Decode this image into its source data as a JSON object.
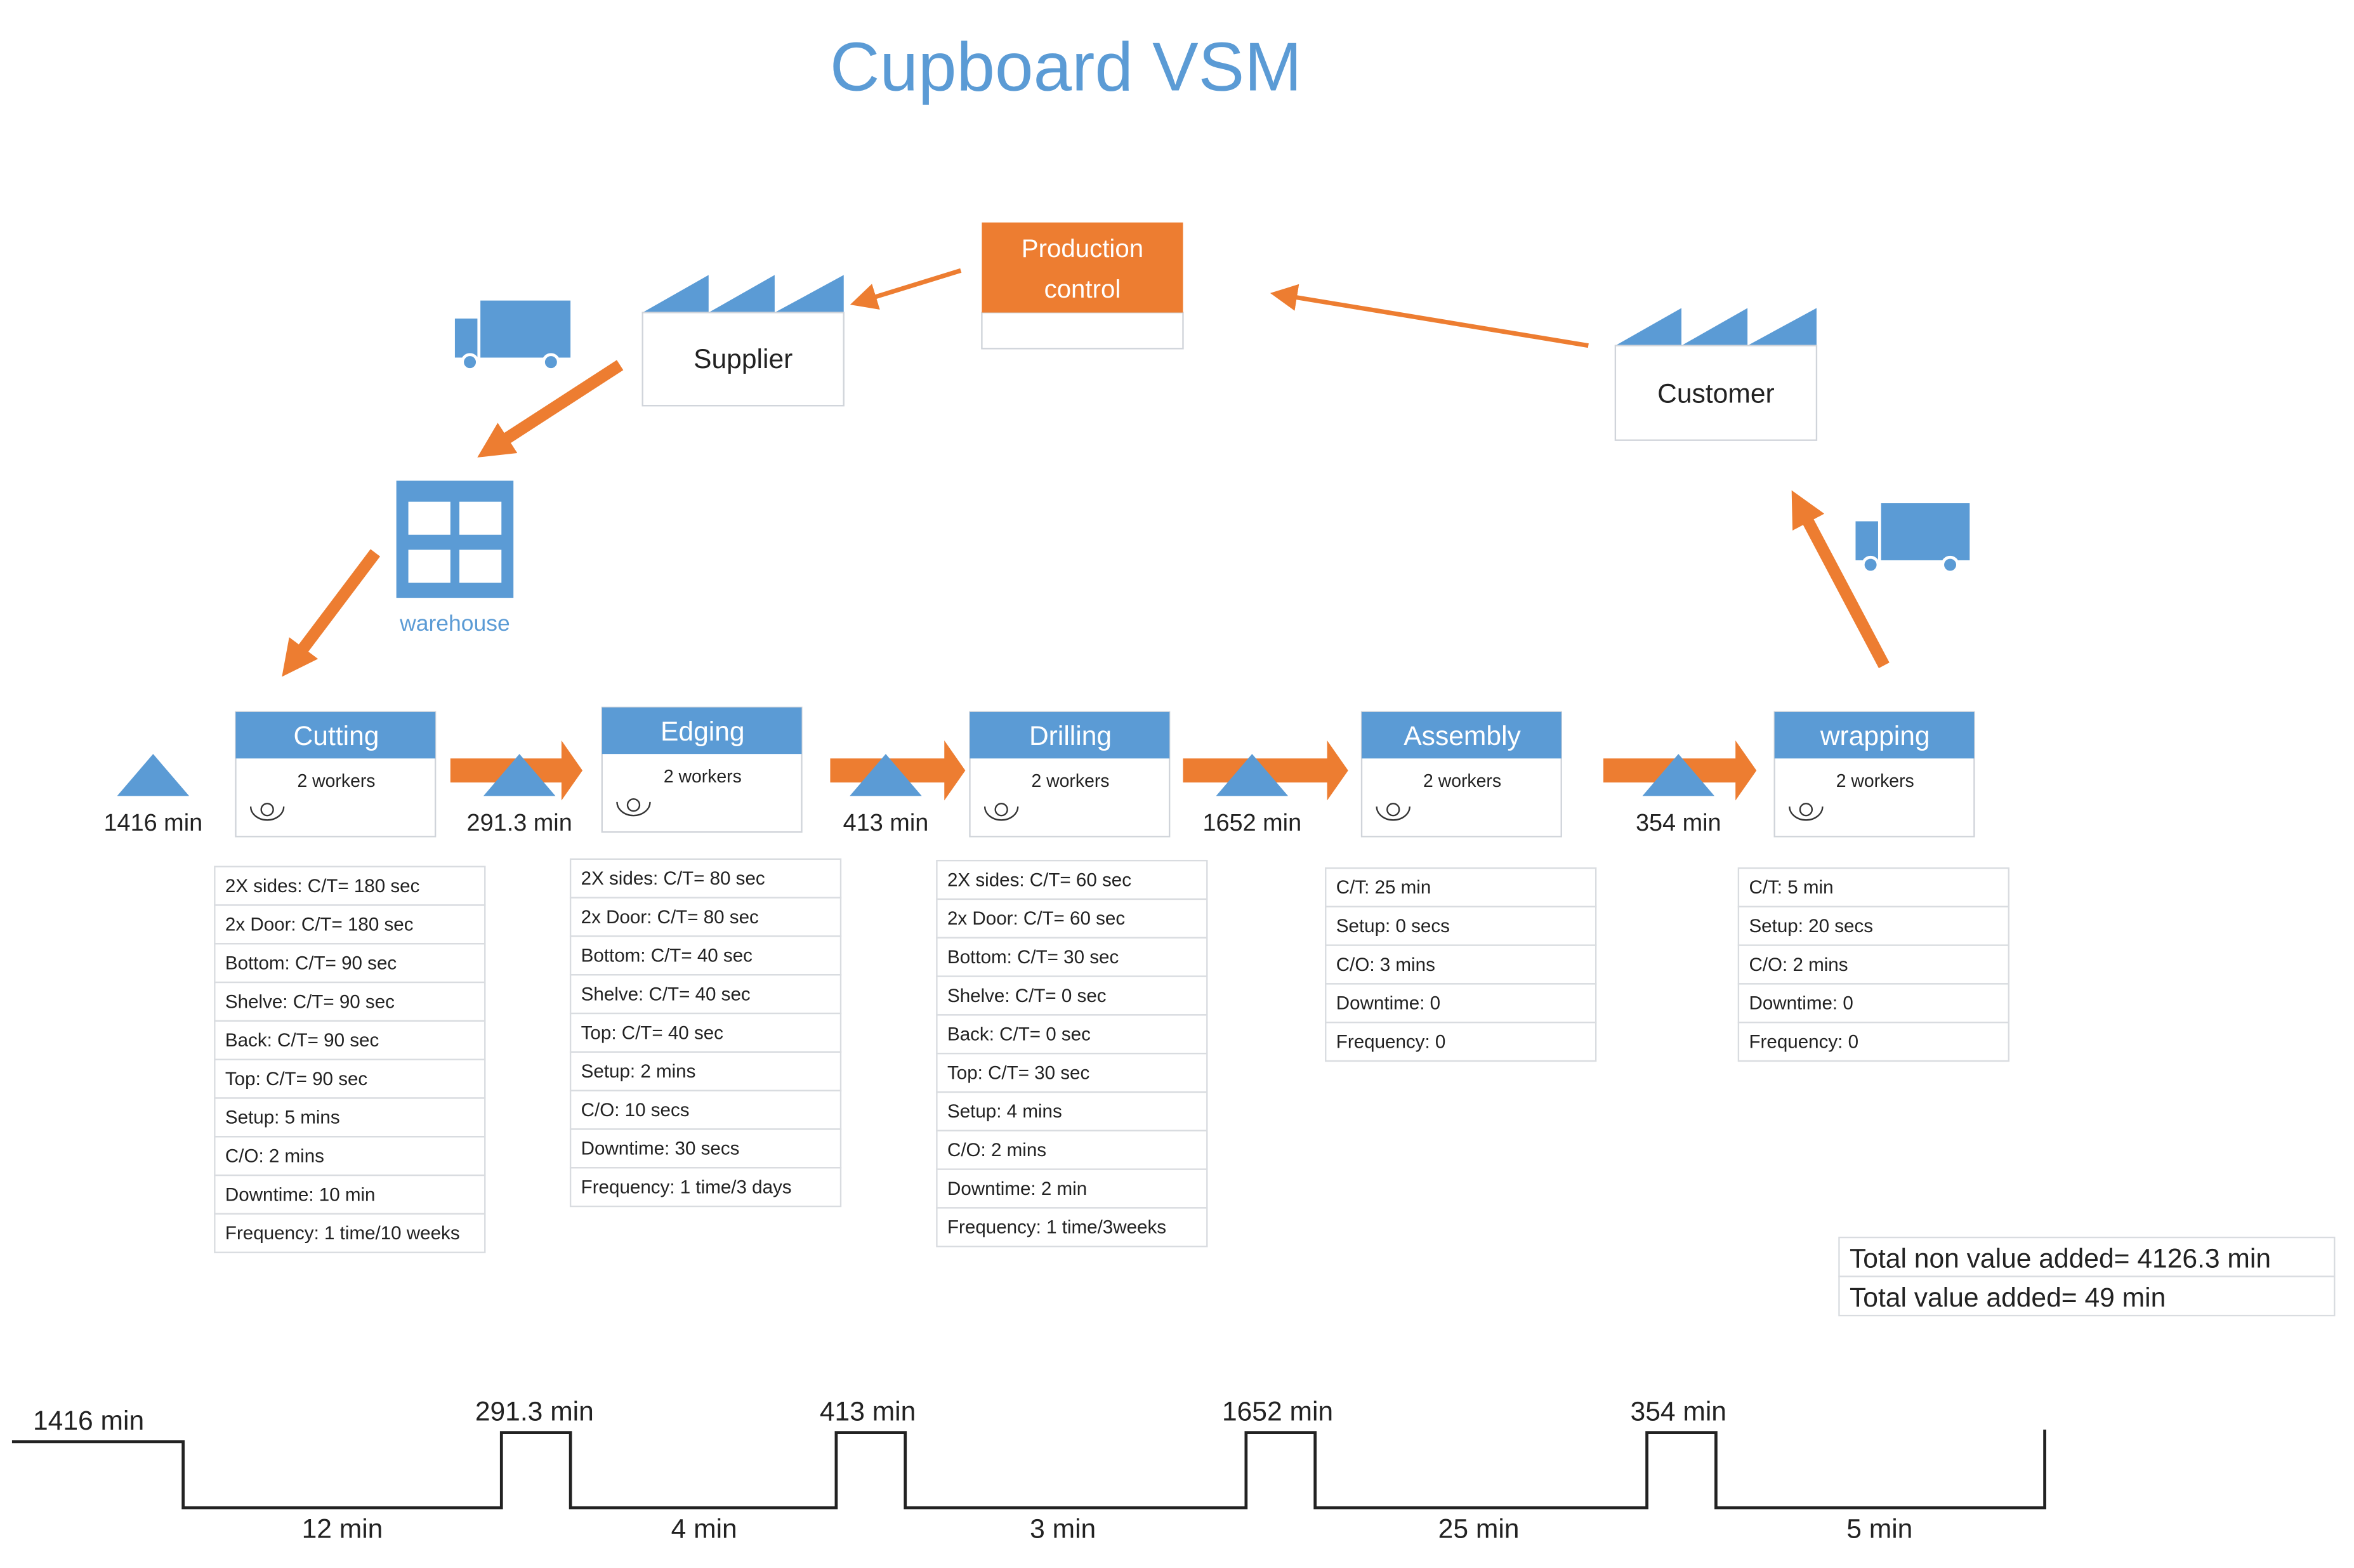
{
  "title": "Cupboard VSM",
  "colors": {
    "accent_blue": "#5b9bd5",
    "accent_orange": "#ed7d31"
  },
  "production_control": {
    "line1": "Production",
    "line2": "control"
  },
  "supplier": {
    "label": "Supplier",
    "icon": "factory-icon"
  },
  "customer": {
    "label": "Customer",
    "icon": "factory-icon"
  },
  "warehouse": {
    "label": "warehouse",
    "icon": "warehouse-icon"
  },
  "processes": [
    {
      "name": "Cutting",
      "workers": "2 workers",
      "rows": [
        "2X sides: C/T= 180 sec",
        "2x Door: C/T= 180 sec",
        "Bottom: C/T= 90 sec",
        "Shelve: C/T= 90 sec",
        "Back: C/T= 90 sec",
        "Top: C/T= 90 sec",
        "Setup: 5 mins",
        "C/O: 2 mins",
        "Downtime: 10 min",
        "Frequency: 1 time/10 weeks"
      ]
    },
    {
      "name": "Edging",
      "workers": "2 workers",
      "rows": [
        "2X sides: C/T= 80 sec",
        "2x Door: C/T= 80 sec",
        "Bottom: C/T= 40 sec",
        "Shelve: C/T= 40 sec",
        "Top: C/T= 40 sec",
        "Setup: 2 mins",
        "C/O: 10 secs",
        "Downtime: 30 secs",
        "Frequency: 1 time/3 days"
      ]
    },
    {
      "name": "Drilling",
      "workers": "2 workers",
      "rows": [
        "2X sides: C/T= 60 sec",
        "2x Door: C/T= 60 sec",
        "Bottom: C/T= 30 sec",
        "Shelve: C/T= 0 sec",
        "Back: C/T= 0 sec",
        "Top: C/T= 30 sec",
        "Setup: 4 mins",
        "C/O: 2 mins",
        "Downtime: 2 min",
        "Frequency: 1 time/3weeks"
      ]
    },
    {
      "name": "Assembly",
      "workers": "2 workers",
      "rows": [
        "C/T: 25 min",
        "Setup: 0 secs",
        "C/O: 3 mins",
        "Downtime: 0",
        "Frequency: 0"
      ]
    },
    {
      "name": "wrapping",
      "workers": "2 workers",
      "rows": [
        "C/T: 5 min",
        "Setup: 20 secs",
        "C/O: 2 mins",
        "Downtime: 0",
        "Frequency: 0"
      ]
    }
  ],
  "inventory": [
    "1416 min",
    "291.3 min",
    "413 min",
    "1652 min",
    "354 min"
  ],
  "totals": {
    "non_value_added": "Total non value added= 4126.3 min",
    "value_added": "Total value added= 49 min"
  },
  "timeline": {
    "wait_times": [
      "1416 min",
      "291.3 min",
      "413 min",
      "1652 min",
      "354 min"
    ],
    "process_times": [
      "12 min",
      "4 min",
      "3 min",
      "25 min",
      "5 min"
    ]
  }
}
